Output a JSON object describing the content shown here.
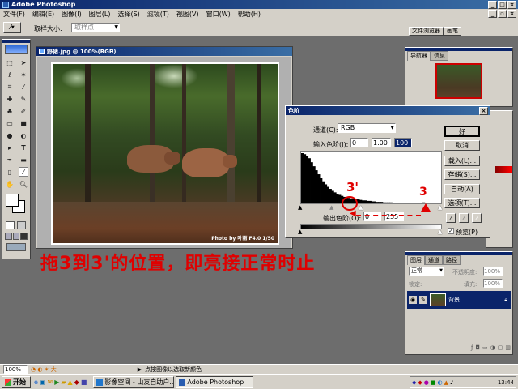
{
  "app": {
    "title": "Adobe Photoshop",
    "menu": [
      "文件(F)",
      "编辑(E)",
      "图像(I)",
      "图层(L)",
      "选择(S)",
      "滤镜(T)",
      "视图(V)",
      "窗口(W)",
      "帮助(H)"
    ]
  },
  "options_bar": {
    "sample_size_label": "取样大小:",
    "sample_size_value": "取样点",
    "tabs": [
      "文件浏览器",
      "画笔"
    ]
  },
  "document": {
    "title": "野猪.jpg @ 100%(RGB)",
    "photo_credit": "Photo by 叶雨 F4.0 1/50"
  },
  "navigator": {
    "tabs": [
      "导航器",
      "信息"
    ]
  },
  "levels_dialog": {
    "title": "色阶",
    "channel_label": "通道(C):",
    "channel_value": "RGB",
    "input_label": "输入色阶(I):",
    "input_values": [
      "0",
      "1.00",
      "100"
    ],
    "output_label": "输出色阶(O):",
    "output_values": [
      "0",
      "255"
    ],
    "buttons": {
      "ok": "好",
      "cancel": "取消",
      "load": "载入(L)...",
      "save": "存储(S)...",
      "auto": "自动(A)",
      "options": "选项(T)..."
    },
    "preview_label": "预览(P)",
    "preview_checked": true
  },
  "annotations": {
    "marker_3prime": "3'",
    "marker_3": "3",
    "caption": "拖3到3'的位置，即亮接正常时止"
  },
  "layers_panel": {
    "tabs": [
      "图层",
      "通道",
      "路径"
    ],
    "blend_mode": "正常",
    "opacity_label": "不透明度:",
    "opacity_value": "100%",
    "lock_label": "锁定:",
    "fill_label": "填充:",
    "fill_value": "100%",
    "layer_name": "背景"
  },
  "status_bar": {
    "zoom": "100%",
    "hint": "点按图像以选取新颜色"
  },
  "taskbar": {
    "start_label": "开始",
    "tasks": [
      "影像空间 - 山友自助户...",
      "Adobe Photoshop"
    ],
    "clock": "13:44"
  },
  "histogram": {
    "values": [
      100,
      98,
      95,
      90,
      82,
      74,
      66,
      58,
      50,
      44,
      38,
      33,
      29,
      25,
      22,
      19,
      17,
      15,
      13,
      12,
      11,
      10,
      9,
      8,
      8,
      7,
      6,
      6,
      5,
      5,
      4,
      4,
      3,
      3,
      3,
      2,
      2,
      2,
      2,
      1,
      1,
      1,
      1,
      1,
      1,
      0,
      0,
      0,
      0,
      0,
      0,
      1,
      2,
      1,
      0,
      0,
      1,
      0,
      0,
      0
    ]
  }
}
